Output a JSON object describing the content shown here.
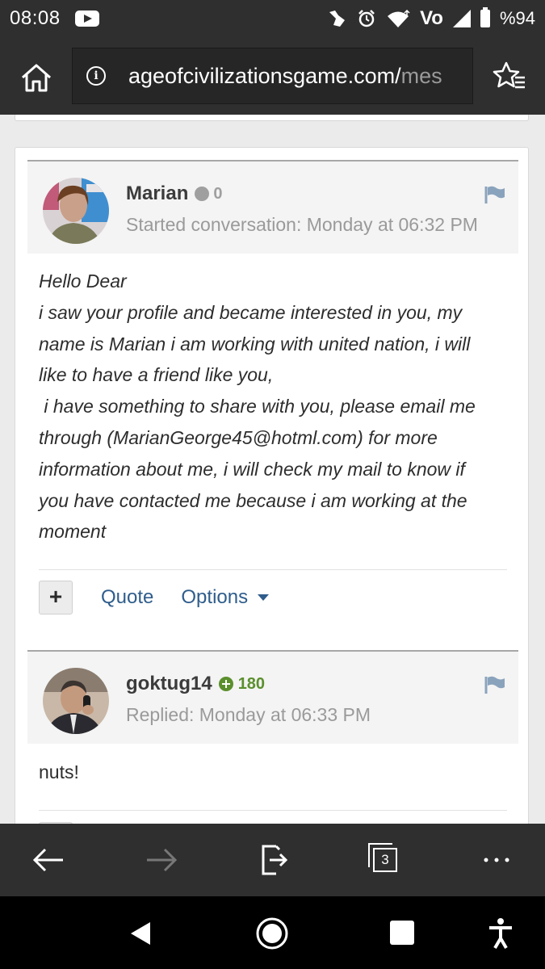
{
  "status_bar": {
    "time": "08:08",
    "network": "Vo",
    "battery": "%94",
    "icons": [
      "youtube-icon",
      "gesture-icon",
      "alarm-icon",
      "wifi-icon",
      "volte-icon",
      "signal-icon",
      "battery-icon"
    ]
  },
  "browser": {
    "url_visible": "ageofcivilizationsgame.com/",
    "url_faded": "mes",
    "icons": [
      "home-icon",
      "info-icon",
      "favorites-icon"
    ]
  },
  "posts": [
    {
      "author": "Marian",
      "reputation": "0",
      "reputation_style": "neutral",
      "meta": "Started conversation: Monday at 06:32 PM",
      "body_lines": [
        "Hello Dear",
        "i saw your profile and became interested in you, my",
        "name is Marian i am working with united nation, i will",
        "like to have a friend like you,",
        " i have something to share with you, please email me",
        "through (MarianGeorge45@hotml.com) for more",
        "information about me, i will check my mail to know if",
        "you have contacted me because i am working at the",
        "moment"
      ],
      "actions": {
        "plus": "+",
        "quote": "Quote",
        "options": "Options"
      }
    },
    {
      "author": "goktug14",
      "reputation": "180",
      "reputation_style": "positive",
      "meta": "Replied: Monday at 06:33 PM",
      "body_lines": [
        "nuts!"
      ]
    }
  ],
  "colors": {
    "link": "#2f5d8c",
    "reputation_positive": "#5b8f2d",
    "reputation_neutral": "#9f9f9f",
    "chrome_dark": "#2f2f2f"
  },
  "toolbar": {
    "tab_count": "3",
    "icons": [
      "back-arrow-icon",
      "forward-arrow-icon",
      "share-exit-icon",
      "tabs-icon",
      "more-icon"
    ]
  },
  "nav_bar": {
    "icons": [
      "nav-back-icon",
      "nav-home-icon",
      "nav-recents-icon",
      "accessibility-icon"
    ]
  }
}
